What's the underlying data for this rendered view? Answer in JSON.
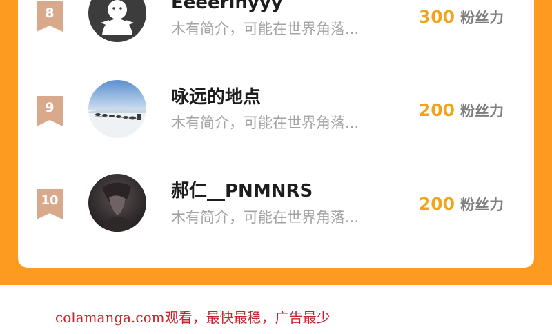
{
  "ranking_list": {
    "items": [
      {
        "rank": "8",
        "name": "Eeeerinyyy",
        "bio": "木有简介，可能在世界角落...",
        "fans_count": "300",
        "fans_label": "粉丝力",
        "avatar": "default-ghost-avatar"
      },
      {
        "rank": "9",
        "name": "咏远的地点",
        "bio": "木有简介，可能在世界角落...",
        "fans_count": "200",
        "fans_label": "粉丝力",
        "avatar": "sled-dogs-snow-photo"
      },
      {
        "rank": "10",
        "name": "郝仁__PNMNRS",
        "bio": "木有简介，可能在世界角落...",
        "fans_count": "200",
        "fans_label": "粉丝力",
        "avatar": "dark-anime-character-photo"
      }
    ]
  },
  "watermark": "colamanga.com观看，最快最稳，广告最少",
  "colors": {
    "frame_orange": "#fc9b20",
    "rank_badge": "#d9a98b",
    "fans_number": "#f1a419",
    "watermark": "#c8222a"
  }
}
